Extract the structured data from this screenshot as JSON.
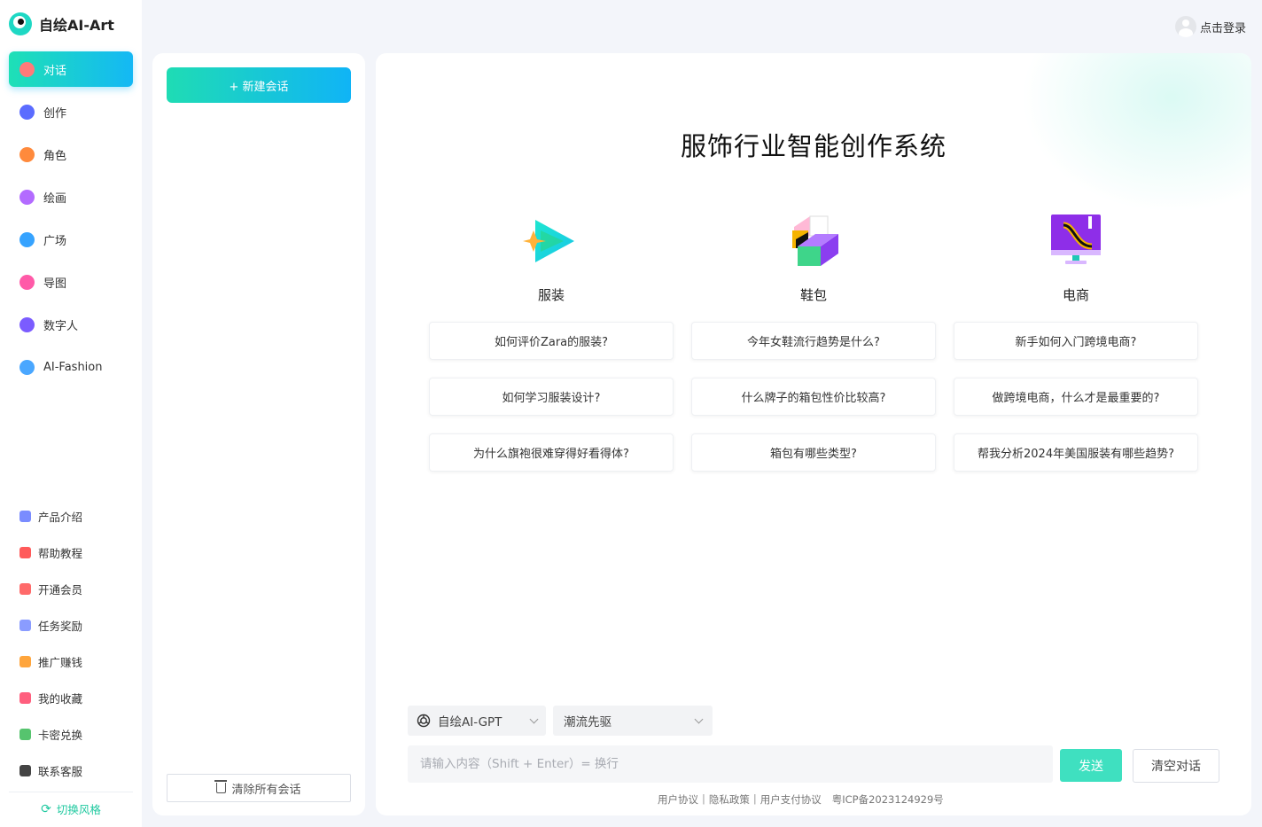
{
  "brand": {
    "name": "自绘AI-Art"
  },
  "nav": {
    "items": [
      {
        "label": "对话",
        "active": true,
        "color": "#ff7a7a"
      },
      {
        "label": "创作",
        "color": "#5b6cff"
      },
      {
        "label": "角色",
        "color": "#ff8a3c"
      },
      {
        "label": "绘画",
        "color": "#b36bff"
      },
      {
        "label": "广场",
        "color": "#36a3ff"
      },
      {
        "label": "导图",
        "color": "#ff5aa8"
      },
      {
        "label": "数字人",
        "color": "#7b5cff"
      },
      {
        "label": "AI-Fashion",
        "color": "#4aa7ff"
      }
    ],
    "sub_items": [
      {
        "label": "产品介绍",
        "color": "#7a8cff"
      },
      {
        "label": "帮助教程",
        "color": "#ff5a5a"
      },
      {
        "label": "开通会员",
        "color": "#ff6a6a"
      },
      {
        "label": "任务奖励",
        "color": "#8a9cff"
      },
      {
        "label": "推广赚钱",
        "color": "#ffa53c"
      },
      {
        "label": "我的收藏",
        "color": "#ff5f7e"
      },
      {
        "label": "卡密兑换",
        "color": "#56c46e"
      },
      {
        "label": "联系客服",
        "color": "#444444"
      }
    ],
    "switch_style": "切换风格"
  },
  "session": {
    "new_chat": "+ 新建会话",
    "clear_all": "清除所有会话"
  },
  "header": {
    "login": "点击登录"
  },
  "main": {
    "title": "服饰行业智能创作系统",
    "categories": [
      {
        "label": "服装",
        "icon": "play-arrow-icon"
      },
      {
        "label": "鞋包",
        "icon": "cube-icon"
      },
      {
        "label": "电商",
        "icon": "monitor-icon"
      }
    ],
    "questions": [
      [
        "如何评价Zara的服装?",
        "今年女鞋流行趋势是什么?",
        "新手如何入门跨境电商?"
      ],
      [
        "如何学习服装设计?",
        "什么牌子的箱包性价比较高?",
        "做跨境电商，什么才是最重要的?"
      ],
      [
        "为什么旗袍很难穿得好看得体?",
        "箱包有哪些类型?",
        "帮我分析2024年美国服装有哪些趋势?"
      ]
    ]
  },
  "composer": {
    "model": "自绘AI-GPT",
    "role": "潮流先驱",
    "input_placeholder": "请输入内容（Shift + Enter）= 换行",
    "send": "发送",
    "clear_chat": "清空对话"
  },
  "footer": {
    "links": [
      "用户协议",
      "隐私政策",
      "用户支付协议"
    ],
    "separator": "|",
    "icp": "粤ICP备2023124929号"
  },
  "colors": {
    "accent_start": "#1fdcb4",
    "accent_end": "#10b4f6",
    "send": "#3fe0c0"
  }
}
